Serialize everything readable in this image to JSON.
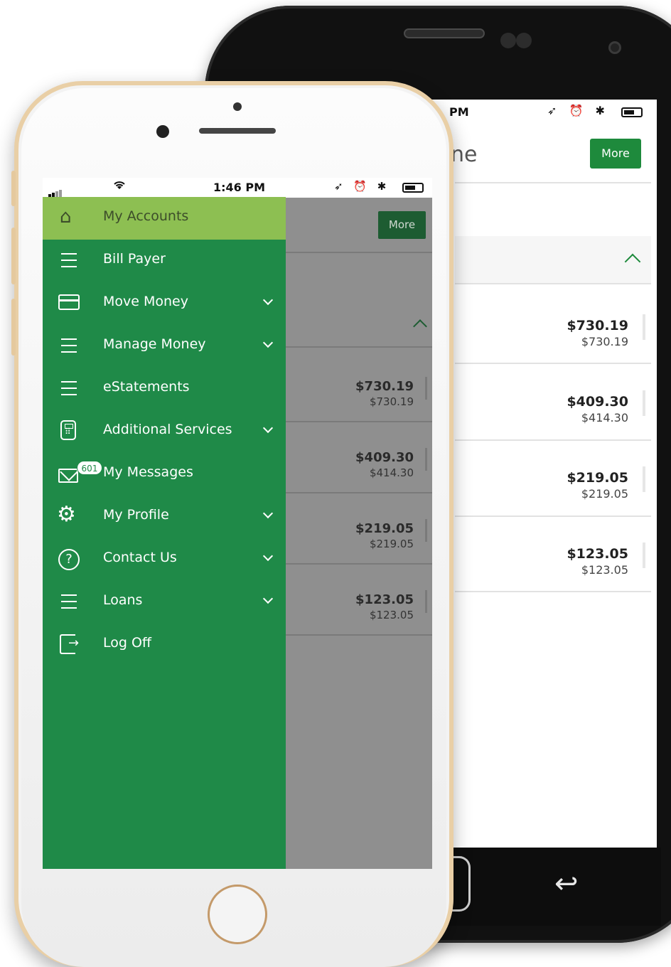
{
  "back_phone": {
    "status_time": "PM",
    "status_icons": "➶ ⏰ ✱",
    "title_fragment": "ne",
    "more_label": "More",
    "accounts": [
      {
        "amount": "$730.19",
        "available": "$730.19"
      },
      {
        "amount": "$409.30",
        "available": "$414.30"
      },
      {
        "amount": "$219.05",
        "available": "$219.05"
      },
      {
        "amount": "$123.05",
        "available": "$123.05"
      }
    ],
    "back_icon": "↩"
  },
  "status_bar": {
    "time": "1:46 PM",
    "wifi_icon": "wifi-icon",
    "right_icons": "➶ ⏰ ✱"
  },
  "menu": {
    "items": [
      {
        "label": "My Accounts",
        "icon": "home-icon",
        "active": true,
        "has_chevron": false
      },
      {
        "label": "Bill Payer",
        "icon": "menu-lines-icon",
        "has_chevron": false
      },
      {
        "label": "Move Money",
        "icon": "card-icon",
        "has_chevron": true
      },
      {
        "label": "Manage Money",
        "icon": "menu-lines-icon",
        "has_chevron": true
      },
      {
        "label": "eStatements",
        "icon": "menu-lines-icon",
        "has_chevron": false
      },
      {
        "label": "Additional Services",
        "icon": "calculator-icon",
        "has_chevron": true
      },
      {
        "label": "My Messages",
        "icon": "envelope-icon",
        "has_chevron": false,
        "badge": "601"
      },
      {
        "label": "My Profile",
        "icon": "gear-icon",
        "has_chevron": true
      },
      {
        "label": "Contact Us",
        "icon": "help-circle-icon",
        "has_chevron": true
      },
      {
        "label": "Loans",
        "icon": "menu-lines-icon",
        "has_chevron": true
      },
      {
        "label": "Log Off",
        "icon": "logoff-icon",
        "has_chevron": false
      }
    ]
  },
  "dimmed_page": {
    "more_label": "More",
    "accounts": [
      {
        "amount": "$730.19",
        "available": "$730.19"
      },
      {
        "amount": "$409.30",
        "available": "$414.30"
      },
      {
        "amount": "$219.05",
        "available": "$219.05"
      },
      {
        "amount": "$123.05",
        "available": "$123.05"
      }
    ]
  },
  "colors": {
    "menu_green": "#1f8a48",
    "active_green": "#8dbf52",
    "button_green": "#1e8a3c",
    "dim_overlay": "#8f8f8f"
  }
}
